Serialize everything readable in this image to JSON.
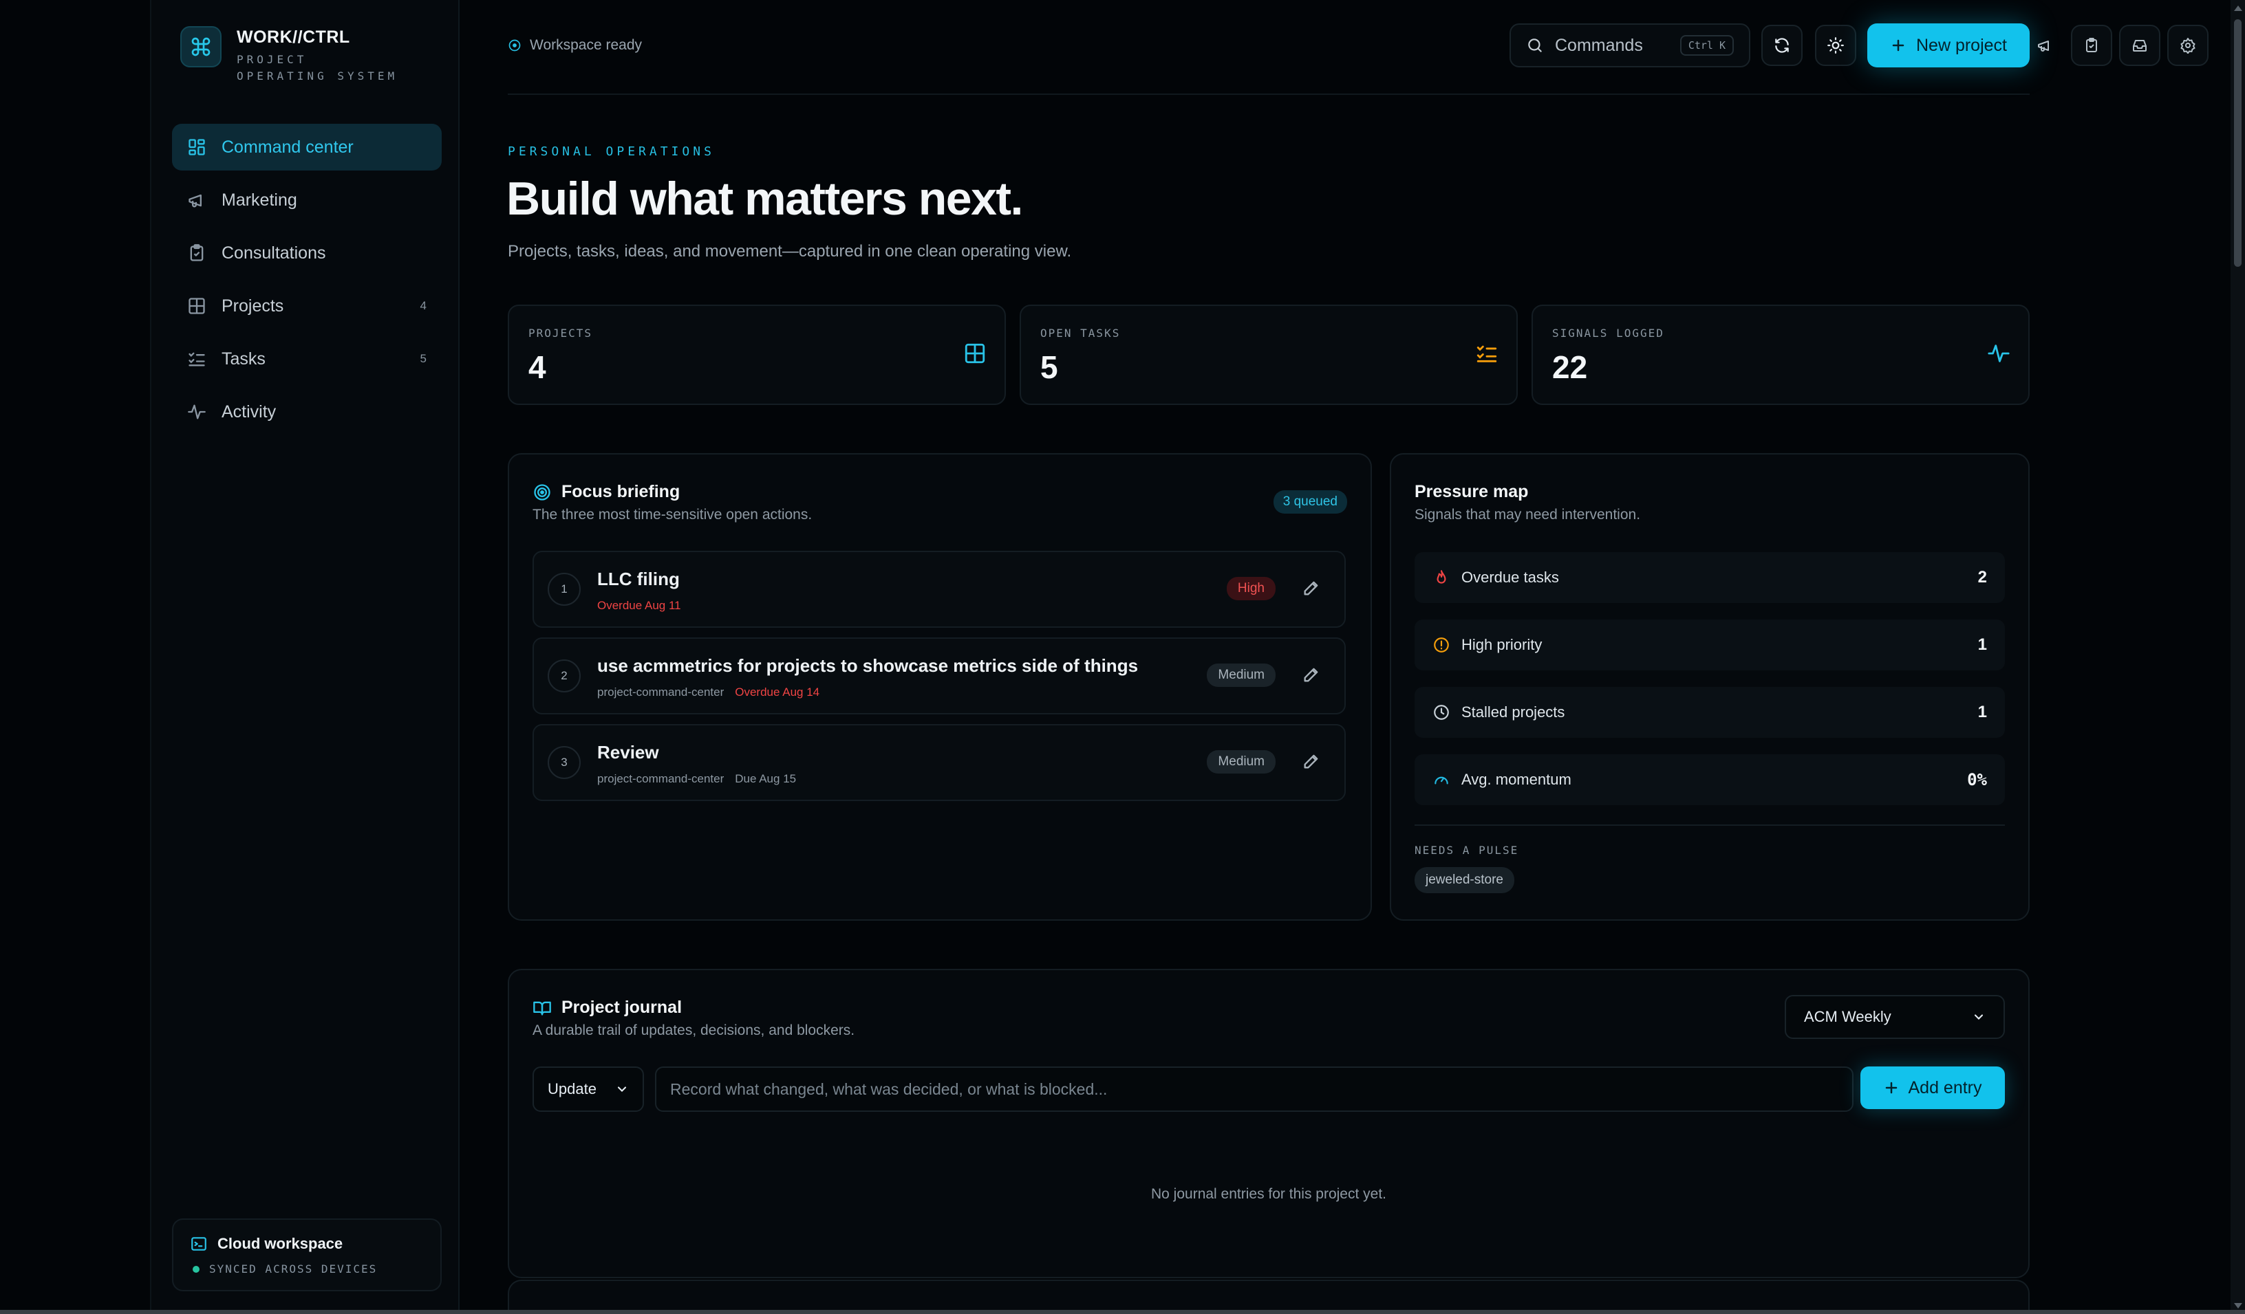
{
  "brand": {
    "name": "WORK//CTRL",
    "subtitle": "PROJECT OPERATING SYSTEM"
  },
  "sidebar": {
    "items": [
      {
        "label": "Command center",
        "icon": "dashboard-icon",
        "active": true,
        "count": ""
      },
      {
        "label": "Marketing",
        "icon": "megaphone-icon",
        "active": false,
        "count": ""
      },
      {
        "label": "Consultations",
        "icon": "clipboard-icon",
        "active": false,
        "count": ""
      },
      {
        "label": "Projects",
        "icon": "grid-icon",
        "active": false,
        "count": "4"
      },
      {
        "label": "Tasks",
        "icon": "checklist-icon",
        "active": false,
        "count": "5"
      },
      {
        "label": "Activity",
        "icon": "pulse-icon",
        "active": false,
        "count": ""
      }
    ],
    "cloud": {
      "title": "Cloud workspace",
      "status": "SYNCED ACROSS DEVICES"
    }
  },
  "topbar": {
    "status": "Workspace ready",
    "commands_label": "Commands",
    "commands_shortcut": "Ctrl K",
    "new_project_label": "New project"
  },
  "hero": {
    "eyebrow": "PERSONAL OPERATIONS",
    "title": "Build what matters next.",
    "subtitle": "Projects, tasks, ideas, and movement—captured in one clean operating view."
  },
  "stats": [
    {
      "label": "PROJECTS",
      "value": "4"
    },
    {
      "label": "OPEN TASKS",
      "value": "5"
    },
    {
      "label": "SIGNALS LOGGED",
      "value": "22"
    }
  ],
  "focus": {
    "title": "Focus briefing",
    "subtitle": "The three most time-sensitive open actions.",
    "badge": "3 queued",
    "tasks": [
      {
        "num": "1",
        "title": "LLC filing",
        "project": "",
        "date": "Overdue Aug 11",
        "overdue": true,
        "priority": "High"
      },
      {
        "num": "2",
        "title": "use acmmetrics for projects to showcase metrics side of things",
        "project": "project-command-center",
        "date": "Overdue Aug 14",
        "overdue": true,
        "priority": "Medium"
      },
      {
        "num": "3",
        "title": "Review",
        "project": "project-command-center",
        "date": "Due Aug 15",
        "overdue": false,
        "priority": "Medium"
      }
    ]
  },
  "pressure": {
    "title": "Pressure map",
    "subtitle": "Signals that may need intervention.",
    "rows": [
      {
        "label": "Overdue tasks",
        "value": "2",
        "color": "#ef4444"
      },
      {
        "label": "High priority",
        "value": "1",
        "color": "#f59e0b"
      },
      {
        "label": "Stalled projects",
        "value": "1",
        "color": "#c9d2d9"
      },
      {
        "label": "Avg. momentum",
        "value": "0%",
        "color": "#22b8e0"
      }
    ],
    "pulse_label": "NEEDS A PULSE",
    "pulse_chip": "jeweled-store"
  },
  "journal": {
    "title": "Project journal",
    "subtitle": "A durable trail of updates, decisions, and blockers.",
    "project_select": "ACM Weekly",
    "type_select": "Update",
    "input_placeholder": "Record what changed, what was decided, or what is blocked...",
    "add_label": "Add entry",
    "empty": "No journal entries for this project yet."
  },
  "colors": {
    "accent": "#12c2ec",
    "danger": "#ef4444",
    "warning": "#f59e0b"
  }
}
